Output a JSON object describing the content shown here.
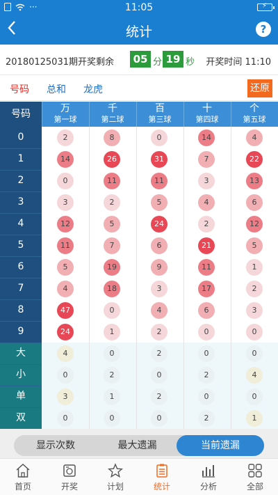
{
  "statusbar": {
    "time": "11:05",
    "dots": "···"
  },
  "navbar": {
    "title": "统计",
    "help": "?"
  },
  "countdown": {
    "period": "20180125031期开奖剩余",
    "minutes": "05",
    "minutes_unit": "分",
    "seconds": "19",
    "seconds_unit": "秒",
    "open_time": "开奖时间 11:10"
  },
  "tabs": [
    {
      "label": "号码",
      "active": true
    },
    {
      "label": "总和",
      "active": false
    },
    {
      "label": "龙虎",
      "active": false
    }
  ],
  "restore_label": "还原",
  "table": {
    "row_header": "号码",
    "columns": [
      {
        "top": "万",
        "bottom": "第一球"
      },
      {
        "top": "千",
        "bottom": "第二球"
      },
      {
        "top": "百",
        "bottom": "第三球"
      },
      {
        "top": "十",
        "bottom": "第四球"
      },
      {
        "top": "个",
        "bottom": "第五球"
      }
    ],
    "number_rows": [
      {
        "label": "0",
        "values": [
          2,
          8,
          0,
          14,
          4
        ]
      },
      {
        "label": "1",
        "values": [
          14,
          26,
          31,
          7,
          22
        ]
      },
      {
        "label": "2",
        "values": [
          0,
          11,
          11,
          3,
          13
        ]
      },
      {
        "label": "3",
        "values": [
          3,
          2,
          5,
          4,
          6
        ]
      },
      {
        "label": "4",
        "values": [
          12,
          5,
          24,
          2,
          12
        ]
      },
      {
        "label": "5",
        "values": [
          11,
          7,
          6,
          21,
          5
        ]
      },
      {
        "label": "6",
        "values": [
          5,
          19,
          9,
          11,
          1
        ]
      },
      {
        "label": "7",
        "values": [
          4,
          18,
          3,
          17,
          2
        ]
      },
      {
        "label": "8",
        "values": [
          47,
          0,
          4,
          6,
          3
        ]
      },
      {
        "label": "9",
        "values": [
          24,
          1,
          2,
          0,
          0
        ]
      }
    ],
    "attr_rows": [
      {
        "label": "大",
        "values": [
          4,
          0,
          2,
          0,
          0
        ]
      },
      {
        "label": "小",
        "values": [
          0,
          2,
          0,
          2,
          4
        ]
      },
      {
        "label": "单",
        "values": [
          3,
          1,
          2,
          0,
          0
        ]
      },
      {
        "label": "双",
        "values": [
          0,
          0,
          0,
          2,
          1
        ]
      }
    ],
    "attr_highlight": [
      [
        true,
        false,
        false,
        false,
        false
      ],
      [
        false,
        false,
        false,
        false,
        true
      ],
      [
        true,
        false,
        false,
        false,
        false
      ],
      [
        false,
        false,
        false,
        false,
        true
      ]
    ]
  },
  "segmented": [
    {
      "label": "显示次数",
      "active": false
    },
    {
      "label": "最大遗漏",
      "active": false
    },
    {
      "label": "当前遗漏",
      "active": true
    }
  ],
  "bottom_nav": [
    {
      "label": "首页",
      "icon": "home-icon",
      "active": false
    },
    {
      "label": "开奖",
      "icon": "lottery-icon",
      "active": false
    },
    {
      "label": "计划",
      "icon": "star-icon",
      "active": false
    },
    {
      "label": "统计",
      "icon": "stats-icon",
      "active": true
    },
    {
      "label": "分析",
      "icon": "analysis-icon",
      "active": false
    },
    {
      "label": "全部",
      "icon": "grid-icon",
      "active": false
    }
  ],
  "colors": {
    "primary": "#1a7fd1",
    "accent": "#f3691e",
    "countdown_green": "#2c9b3c",
    "row_header": "#1f4f7e",
    "attr_header": "#1a7a82"
  }
}
